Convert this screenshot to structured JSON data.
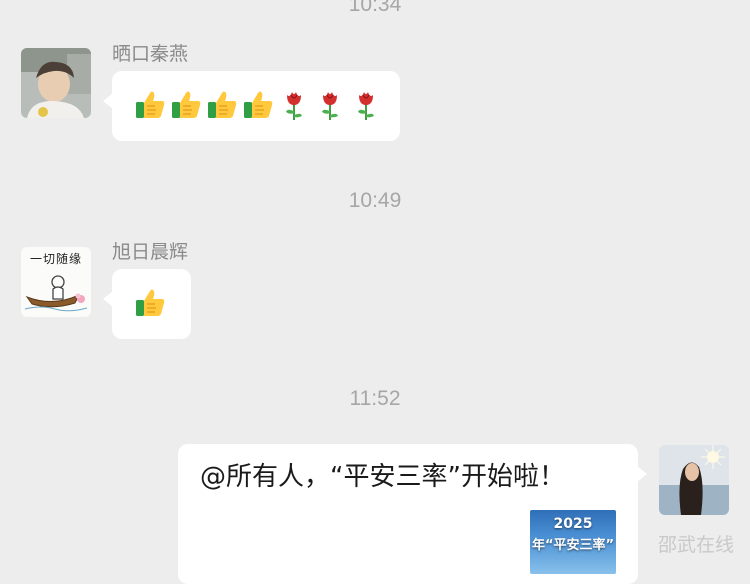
{
  "chat": {
    "timestamps": [
      "10:34",
      "10:49",
      "11:52"
    ],
    "messages": [
      {
        "sender": "晒口秦燕",
        "avatar_icon": "person-photo-avatar",
        "content": [
          "thumbs-up-icon",
          "thumbs-up-icon",
          "thumbs-up-icon",
          "thumbs-up-icon",
          "rose-icon",
          "rose-icon",
          "rose-icon"
        ]
      },
      {
        "sender": "旭日晨辉",
        "avatar_icon": "boat-sketch-avatar",
        "avatar_text": "一切随缘",
        "content": [
          "thumbs-up-icon"
        ]
      },
      {
        "side": "right",
        "avatar_icon": "girl-photo-avatar",
        "text": "@所有人，“平安三率”开始啦！",
        "share_card": {
          "year": "2025",
          "title": "年“平安三率”"
        }
      }
    ]
  },
  "watermark": "邵武在线"
}
